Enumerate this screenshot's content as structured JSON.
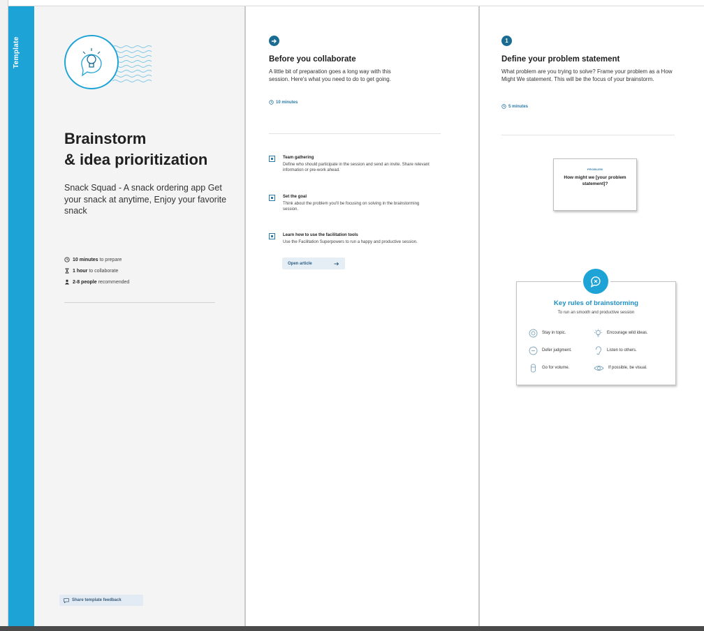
{
  "template_tag": "Template",
  "intro": {
    "title_line1": "Brainstorm",
    "title_line2": "& idea prioritization",
    "subtitle": "Snack Squad - A snack ordering app Get your snack at anytime, Enjoy your favorite snack",
    "meta": [
      {
        "icon": "clock-icon",
        "bold": "10 minutes",
        "rest": " to prepare"
      },
      {
        "icon": "hourglass-icon",
        "bold": "1 hour",
        "rest": " to collaborate"
      },
      {
        "icon": "person-icon",
        "bold": "2-8 people",
        "rest": " recommended"
      }
    ],
    "feedback_label": "Share template feedback"
  },
  "before": {
    "step_icon": "arrow-right-icon",
    "title": "Before you collaborate",
    "desc": "A little bit of preparation goes a long way with this session. Here's what you need to do to get going.",
    "time": "10 minutes",
    "tasks": [
      {
        "title": "Team gathering",
        "desc": "Define who should participate in the session and send an invite. Share relevant information or pre-work ahead."
      },
      {
        "title": "Set the goal",
        "desc": "Think about the problem you'll be focusing on solving in the brainstorming session."
      },
      {
        "title": "Learn how to use the facilitation tools",
        "desc": "Use the Facilitation Superpowers to run a happy and productive session."
      }
    ],
    "open_article": "Open article"
  },
  "define": {
    "step_number": "1",
    "title": "Define your problem statement",
    "desc": "What problem are you trying to solve? Frame your problem as a How Might We statement. This will be the focus of your brainstorm.",
    "time": "5 minutes",
    "note_label": "PROBLEM",
    "note_question": "How might we [your problem statement]?",
    "rules_title": "Key rules of brainstorming",
    "rules_subtitle": "To run an smooth and productive session",
    "rules": [
      {
        "icon": "target-icon",
        "label": "Stay in topic."
      },
      {
        "icon": "lightbulb-icon",
        "label": "Encourage wild ideas."
      },
      {
        "icon": "ban-icon",
        "label": "Defer judgment."
      },
      {
        "icon": "ear-icon",
        "label": "Listen to others."
      },
      {
        "icon": "volume-icon",
        "label": "Go for volume."
      },
      {
        "icon": "eye-icon",
        "label": "If possible, be visual."
      }
    ]
  },
  "colors": {
    "accent": "#1ea3d7",
    "dark_accent": "#1a6c93",
    "link": "#2a79a8"
  }
}
